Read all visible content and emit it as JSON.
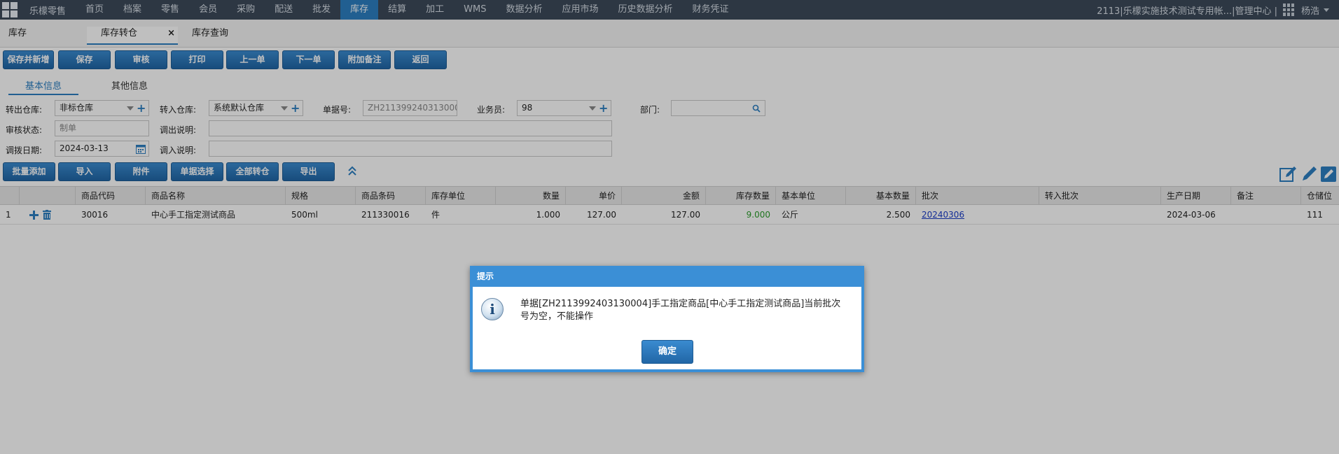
{
  "nav": {
    "brand": "乐檬零售",
    "items": [
      "首页",
      "档案",
      "零售",
      "会员",
      "采购",
      "配送",
      "批发",
      "库存",
      "结算",
      "加工",
      "WMS",
      "数据分析",
      "应用市场",
      "历史数据分析",
      "财务凭证"
    ],
    "active_index": 7,
    "account": "2113|乐檬实施技术测试专用帐...|管理中心 |",
    "user": "杨浩"
  },
  "page_tabs": [
    {
      "label": "库存",
      "active": false,
      "closable": false
    },
    {
      "label": "库存转仓",
      "active": true,
      "closable": true,
      "close_label": "×"
    },
    {
      "label": "库存查询",
      "active": false,
      "closable": false
    }
  ],
  "toolbar": {
    "buttons": [
      "保存并新增",
      "保存",
      "审核",
      "打印",
      "上一单",
      "下一单",
      "附加备注",
      "返回"
    ]
  },
  "sub_tabs": [
    {
      "label": "基本信息",
      "active": true
    },
    {
      "label": "其他信息",
      "active": false
    }
  ],
  "form": {
    "out_warehouse": {
      "label": "转出仓库:",
      "value": "非标仓库"
    },
    "in_warehouse": {
      "label": "转入仓库:",
      "value": "系统默认仓库"
    },
    "doc_no": {
      "label": "单据号:",
      "value": "ZH2113992403130004"
    },
    "salesman": {
      "label": "业务员:",
      "value": "98"
    },
    "dept": {
      "label": "部门:",
      "value": ""
    },
    "audit_status": {
      "label": "审核状态:",
      "value": "制单"
    },
    "out_note": {
      "label": "调出说明:",
      "value": ""
    },
    "transfer_date": {
      "label": "调拨日期:",
      "value": "2024-03-13"
    },
    "in_note": {
      "label": "调入说明:",
      "value": ""
    }
  },
  "table_toolbar": {
    "buttons": [
      "批量添加",
      "导入",
      "附件",
      "单据选择",
      "全部转仓",
      "导出"
    ]
  },
  "table": {
    "columns": [
      "商品代码",
      "商品名称",
      "规格",
      "商品条码",
      "库存单位",
      "数量",
      "单价",
      "金额",
      "库存数量",
      "基本单位",
      "基本数量",
      "批次",
      "转入批次",
      "生产日期",
      "备注",
      "仓储位置"
    ],
    "rows": [
      {
        "index": "1",
        "code": "30016",
        "name": "中心手工指定测试商品",
        "spec": "500ml",
        "barcode": "211330016",
        "unit": "件",
        "qty": "1.000",
        "price": "127.00",
        "amount": "127.00",
        "stock_qty": "9.000",
        "base_unit": "公斤",
        "base_qty": "2.500",
        "batch": "20240306",
        "in_batch": "",
        "prod_date": "2024-03-06",
        "remark": "",
        "location": "111"
      }
    ]
  },
  "dialog": {
    "title": "提示",
    "message": "单据[ZH2113992403130004]手工指定商品[中心手工指定测试商品]当前批次号为空，不能操作",
    "ok_label": "确定",
    "icon_glyph": "i"
  },
  "colors": {
    "nav_bg": "#3c4a5a",
    "accent": "#2c7fc2",
    "dialog_border": "#3b8fd6",
    "stock_green": "#2a9d2a",
    "link": "#1a3cc8"
  }
}
